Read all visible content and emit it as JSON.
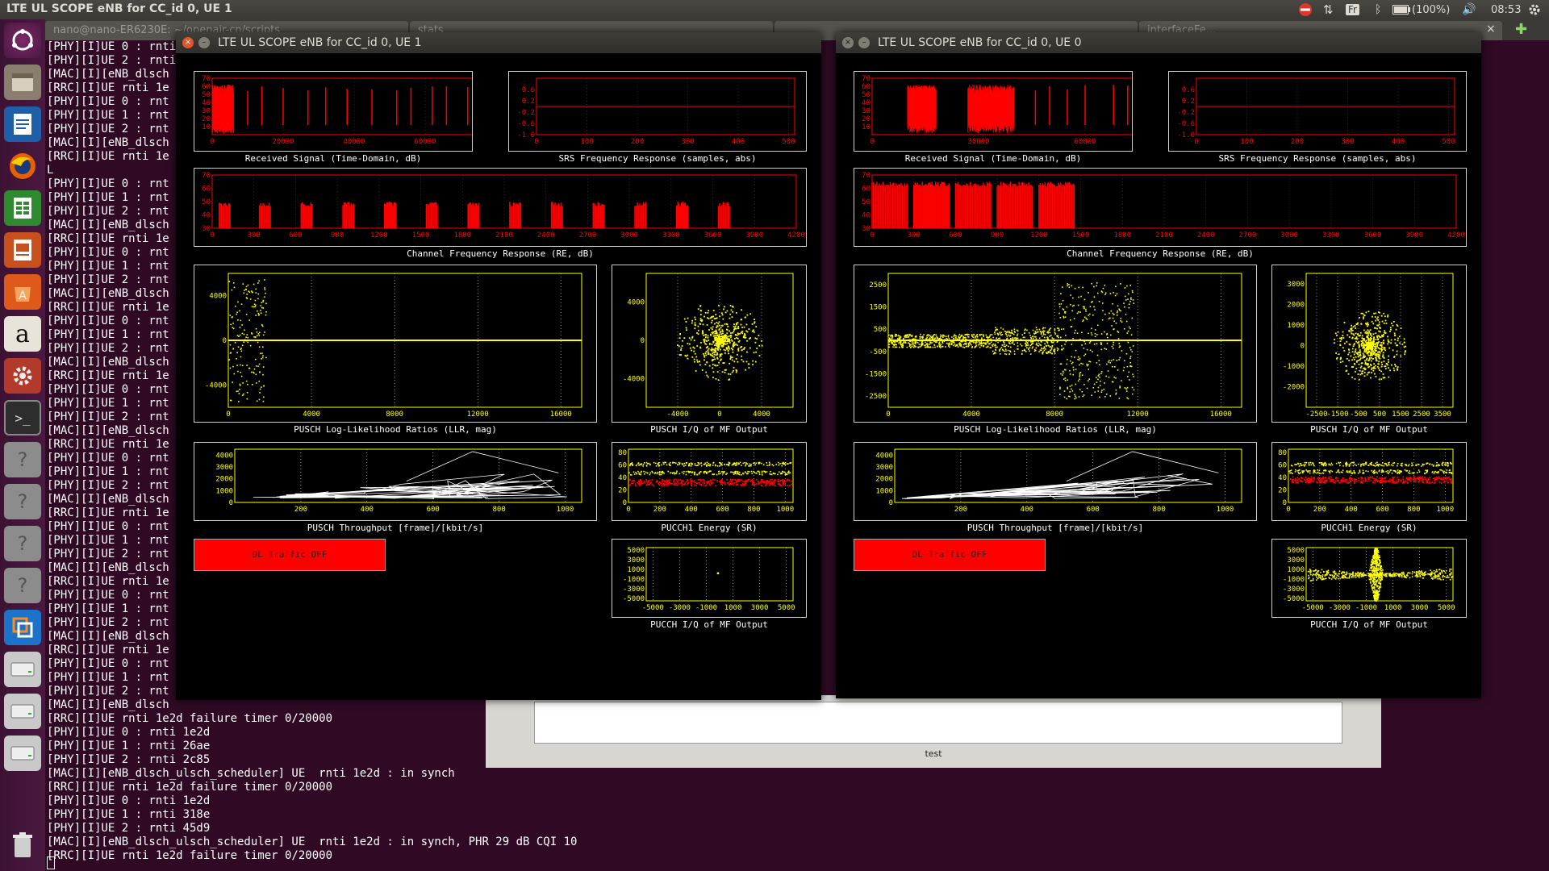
{
  "topbar": {
    "title": "LTE UL SCOPE eNB for CC_id 0, UE 1",
    "keyboard": "Fr",
    "battery": "(100%)",
    "time": "08:53"
  },
  "terminal": {
    "tabs": [
      "nano@nano-ER6230E: ~/openair-cn/scripts",
      "stats",
      "",
      "interfaceFe..."
    ],
    "lines": [
      "[PHY][I]UE 0 : rnti",
      "[PHY][I]UE 2 : rnti",
      "[MAC][I][eNB_dlsch",
      "[RRC][I]UE rnti 1e",
      "[PHY][I]UE 0 : rnt",
      "[PHY][I]UE 1 : rnt",
      "[PHY][I]UE 2 : rnt",
      "[MAC][I][eNB_dlsch",
      "[RRC][I]UE rnti 1e",
      "L",
      "[PHY][I]UE 0 : rnt",
      "[PHY][I]UE 1 : rnt",
      "[PHY][I]UE 2 : rnt",
      "[MAC][I][eNB_dlsch",
      "[RRC][I]UE rnti 1e",
      "[PHY][I]UE 0 : rnt",
      "[PHY][I]UE 1 : rnt",
      "[PHY][I]UE 2 : rnt",
      "[MAC][I][eNB_dlsch",
      "[RRC][I]UE rnti 1e",
      "[PHY][I]UE 0 : rnt",
      "[PHY][I]UE 1 : rnt",
      "[PHY][I]UE 2 : rnt",
      "[MAC][I][eNB_dlsch",
      "[RRC][I]UE rnti 1e",
      "[PHY][I]UE 0 : rnt",
      "[PHY][I]UE 1 : rnt",
      "[PHY][I]UE 2 : rnt",
      "[MAC][I][eNB_dlsch",
      "[RRC][I]UE rnti 1e",
      "[PHY][I]UE 0 : rnt",
      "[PHY][I]UE 1 : rnt",
      "[PHY][I]UE 2 : rnt",
      "[MAC][I][eNB_dlsch",
      "[RRC][I]UE rnti 1e",
      "[PHY][I]UE 0 : rnt",
      "[PHY][I]UE 1 : rnt",
      "[PHY][I]UE 2 : rnt",
      "[MAC][I][eNB_dlsch",
      "[RRC][I]UE rnti 1e",
      "[PHY][I]UE 0 : rnt",
      "[PHY][I]UE 1 : rnt",
      "[PHY][I]UE 2 : rnt",
      "[MAC][I][eNB_dlsch",
      "[RRC][I]UE rnti 1e",
      "[PHY][I]UE 0 : rnt",
      "[PHY][I]UE 1 : rnt",
      "[PHY][I]UE 2 : rnt",
      "[MAC][I][eNB_dlsch",
      "[RRC][I]UE rnti 1e2d failure timer 0/20000",
      "[PHY][I]UE 0 : rnti 1e2d",
      "[PHY][I]UE 1 : rnti 26ae",
      "[PHY][I]UE 2 : rnti 2c85",
      "[MAC][I][eNB_dlsch_ulsch_scheduler] UE  rnti 1e2d : in synch",
      "[RRC][I]UE rnti 1e2d failure timer 0/20000",
      "[PHY][I]UE 0 : rnti 1e2d",
      "[PHY][I]UE 1 : rnti 318e",
      "[PHY][I]UE 2 : rnti 45d9",
      "[MAC][I][eNB_dlsch_ulsch_scheduler] UE  rnti 1e2d : in synch, PHR 29 dB CQI 10",
      "[RRC][I]UE rnti 1e2d failure timer 0/20000"
    ]
  },
  "test_window": {
    "label": "test"
  },
  "scope_windows": [
    {
      "title": "LTE UL SCOPE eNB for CC_id 0, UE 1",
      "close": "×",
      "minimize": "–",
      "dl_button": "DL Traffic OFF",
      "plots": [
        {
          "id": "rx",
          "caption": "Received Signal (Time-Domain, dB)",
          "type": "spikes",
          "xlim": [
            0,
            75000
          ],
          "ylim": [
            0,
            70
          ],
          "xticks": [
            "0",
            "20000",
            "40000",
            "60000"
          ],
          "xtick_vals": [
            0,
            20000,
            40000,
            60000
          ],
          "yticks": [
            "70",
            "60",
            "50",
            "40",
            "30",
            "20",
            "10"
          ],
          "ytick_vals": [
            70,
            60,
            50,
            40,
            30,
            20,
            10
          ],
          "dense_region": [
            0,
            6000
          ],
          "spikes": [
            10000,
            14000,
            20000,
            27000,
            32000,
            38000,
            45000,
            52000,
            56000,
            62000,
            66000,
            72000
          ],
          "color": "#ff0000"
        },
        {
          "id": "srs",
          "caption": "SRS Frequency Response (samples, abs)",
          "type": "flat",
          "xlim": [
            0,
            512
          ],
          "ylim": [
            -1,
            1
          ],
          "xticks": [
            "0",
            "100",
            "200",
            "300",
            "400",
            "500"
          ],
          "xtick_vals": [
            0,
            100,
            200,
            300,
            400,
            500
          ],
          "yticks": [
            "0.6",
            "0.2",
            "-0.2",
            "-0.6",
            "-1.0"
          ],
          "ytick_vals": [
            0.6,
            0.2,
            -0.2,
            -0.6,
            -1.0
          ],
          "level": 0,
          "color": "#ff0000"
        },
        {
          "id": "chan",
          "caption": "Channel Frequency  Response (RE, dB)",
          "type": "blocks",
          "xlim": [
            0,
            4200
          ],
          "ylim": [
            30,
            70
          ],
          "xticks": [
            "0",
            "300",
            "600",
            "900",
            "1200",
            "1500",
            "1800",
            "2100",
            "2400",
            "2700",
            "3000",
            "3300",
            "3600",
            "3900",
            "4200"
          ],
          "xtick_vals": [
            0,
            300,
            600,
            900,
            1200,
            1500,
            1800,
            2100,
            2400,
            2700,
            3000,
            3300,
            3600,
            3900,
            4200
          ],
          "yticks": [
            "70",
            "60",
            "50",
            "40",
            "30"
          ],
          "ytick_vals": [
            70,
            60,
            50,
            40,
            30
          ],
          "blocks": [
            [
              50,
              130
            ],
            [
              340,
              420
            ],
            [
              640,
              720
            ],
            [
              940,
              1020
            ],
            [
              1240,
              1320
            ],
            [
              1540,
              1620
            ],
            [
              1840,
              1920
            ],
            [
              2140,
              2220
            ],
            [
              2440,
              2520
            ],
            [
              2740,
              2820
            ],
            [
              3040,
              3120
            ],
            [
              3340,
              3420
            ],
            [
              3640,
              3720
            ]
          ],
          "block_top": 50,
          "color": "#ff0000"
        },
        {
          "id": "llr",
          "caption": "PUSCH Log-Likelihood Ratios (LLR, mag)",
          "type": "llr",
          "xlim": [
            0,
            17000
          ],
          "ylim": [
            -6000,
            6000
          ],
          "xticks": [
            "0",
            "4000",
            "8000",
            "12000",
            "16000"
          ],
          "xtick_vals": [
            0,
            4000,
            8000,
            12000,
            16000
          ],
          "yticks": [
            "4000",
            "0",
            "-4000"
          ],
          "ytick_vals": [
            4000,
            0,
            -4000
          ],
          "noise": [
            [
              0,
              1800,
              5500
            ]
          ],
          "color": "#ffff00"
        },
        {
          "id": "iq",
          "caption": "PUSCH I/Q of MF Output",
          "type": "cloud",
          "xlim": [
            -7000,
            7000
          ],
          "ylim": [
            -7000,
            7000
          ],
          "xticks": [
            "-4000",
            "0",
            "4000"
          ],
          "xtick_vals": [
            -4000,
            0,
            4000
          ],
          "yticks": [
            "4000",
            "0",
            "-4000"
          ],
          "ytick_vals": [
            4000,
            0,
            -4000
          ],
          "spread": 2600,
          "color": "#ffff00"
        },
        {
          "id": "thr",
          "caption": "PUSCH Throughput [frame]/[kbit/s]",
          "type": "throughput",
          "xlim": [
            0,
            1050
          ],
          "ylim": [
            0,
            4500
          ],
          "xticks": [
            "200",
            "400",
            "600",
            "800",
            "1000"
          ],
          "xtick_vals": [
            200,
            400,
            600,
            800,
            1000
          ],
          "yticks": [
            "4000",
            "3000",
            "2000",
            "1000",
            "0"
          ],
          "ytick_vals": [
            4000,
            3000,
            2000,
            1000,
            0
          ],
          "peak": [
            720,
            4300
          ],
          "color": "#ffffff"
        },
        {
          "id": "pucch1",
          "caption": "PUCCH1 Energy (SR)",
          "type": "energy",
          "xlim": [
            0,
            1050
          ],
          "ylim": [
            0,
            85
          ],
          "xticks": [
            "0",
            "200",
            "400",
            "600",
            "800",
            "1000"
          ],
          "xtick_vals": [
            0,
            200,
            400,
            600,
            800,
            1000
          ],
          "yticks": [
            "80",
            "60",
            "40",
            "20",
            "0"
          ],
          "ytick_vals": [
            80,
            60,
            40,
            20,
            0
          ],
          "yellow_level": [
            62,
            48
          ],
          "red_level": 33,
          "color": "#ffff00"
        },
        {
          "id": "pucchiq",
          "caption": "PUCCH I/Q of MF Output",
          "type": "single",
          "xlim": [
            -5500,
            5500
          ],
          "ylim": [
            -5500,
            5500
          ],
          "xticks": [
            "-5000",
            "-3000",
            "-1000",
            "1000",
            "3000",
            "5000"
          ],
          "xtick_vals": [
            -5000,
            -3000,
            -1000,
            1000,
            3000,
            5000
          ],
          "yticks": [
            "5000",
            "3000",
            "1000",
            "-1000",
            "-3000",
            "-5000"
          ],
          "ytick_vals": [
            5000,
            3000,
            1000,
            -1000,
            -3000,
            -5000
          ],
          "point": [
            -200,
            400
          ],
          "color": "#ffff00"
        }
      ]
    },
    {
      "title": "LTE UL SCOPE eNB for CC_id 0, UE 0",
      "close": "×",
      "minimize": "–",
      "dl_button": "DL Traffic OFF",
      "plots": [
        {
          "id": "rx",
          "caption": "Received Signal (Time-Domain, dB)",
          "type": "spikes",
          "xlim": [
            0,
            75000
          ],
          "ylim": [
            0,
            70
          ],
          "xticks": [
            "0",
            "30000",
            "60000"
          ],
          "xtick_vals": [
            0,
            30000,
            60000
          ],
          "yticks": [
            "70",
            "60",
            "50",
            "40",
            "30",
            "20",
            "10"
          ],
          "ytick_vals": [
            70,
            60,
            50,
            40,
            30,
            20,
            10
          ],
          "dense_region": [
            10000,
            18000
          ],
          "dense_region2": [
            27000,
            40000
          ],
          "spikes": [
            46000,
            50000,
            55000,
            60000,
            68000,
            72000
          ],
          "color": "#ff0000"
        },
        {
          "id": "srs",
          "caption": "SRS Frequency Response (samples, abs)",
          "type": "flat",
          "xlim": [
            0,
            512
          ],
          "ylim": [
            -1,
            1
          ],
          "xticks": [
            "0",
            "100",
            "200",
            "300",
            "400",
            "500"
          ],
          "xtick_vals": [
            0,
            100,
            200,
            300,
            400,
            500
          ],
          "yticks": [
            "0.6",
            "0.2",
            "-0.2",
            "-0.6",
            "-1.0"
          ],
          "ytick_vals": [
            0.6,
            0.2,
            -0.2,
            -0.6,
            -1.0
          ],
          "level": 0,
          "color": "#ff0000"
        },
        {
          "id": "chan",
          "caption": "Channel Frequency  Response (RE, dB)",
          "type": "blocks",
          "xlim": [
            0,
            4200
          ],
          "ylim": [
            30,
            70
          ],
          "xticks": [
            "0",
            "300",
            "600",
            "900",
            "1200",
            "1500",
            "1800",
            "2100",
            "2400",
            "2700",
            "3000",
            "3300",
            "3600",
            "3900",
            "4200"
          ],
          "xtick_vals": [
            0,
            300,
            600,
            900,
            1200,
            1500,
            1800,
            2100,
            2400,
            2700,
            3000,
            3300,
            3600,
            3900,
            4200
          ],
          "yticks": [
            "70",
            "60",
            "50",
            "40",
            "30"
          ],
          "ytick_vals": [
            70,
            60,
            50,
            40,
            30
          ],
          "blocks": [
            [
              0,
              260
            ],
            [
              300,
              560
            ],
            [
              600,
              860
            ],
            [
              900,
              1160
            ],
            [
              1200,
              1460
            ]
          ],
          "block_top": 65,
          "color": "#ff0000"
        },
        {
          "id": "llr",
          "caption": "PUSCH Log-Likelihood Ratios (LLR, mag)",
          "type": "llr",
          "xlim": [
            0,
            17000
          ],
          "ylim": [
            -3000,
            3000
          ],
          "xticks": [
            "0",
            "4000",
            "8000",
            "12000",
            "16000"
          ],
          "xtick_vals": [
            0,
            4000,
            8000,
            12000,
            16000
          ],
          "yticks": [
            "2500",
            "1500",
            "500",
            "-500",
            "-1500",
            "-2500"
          ],
          "ytick_vals": [
            2500,
            1500,
            500,
            -500,
            -1500,
            -2500
          ],
          "noise": [
            [
              0,
              5000,
              300
            ],
            [
              5000,
              8200,
              600
            ],
            [
              8200,
              11800,
              2600
            ]
          ],
          "color": "#ffff00"
        },
        {
          "id": "iq",
          "caption": "PUSCH I/Q of MF Output",
          "type": "cloud",
          "xlim": [
            -3000,
            4000
          ],
          "ylim": [
            -3000,
            3500
          ],
          "xticks": [
            "-2500",
            "-1500",
            "-500",
            "500",
            "1500",
            "2500",
            "3500"
          ],
          "xtick_vals": [
            -2500,
            -1500,
            -500,
            500,
            1500,
            2500,
            3500
          ],
          "yticks": [
            "3000",
            "2000",
            "1000",
            "0",
            "-1000",
            "-2000"
          ],
          "ytick_vals": [
            3000,
            2000,
            1000,
            0,
            -1000,
            -2000
          ],
          "spread": 1100,
          "color": "#ffff00"
        },
        {
          "id": "thr",
          "caption": "PUSCH Throughput [frame]/[kbit/s]",
          "type": "throughput",
          "xlim": [
            0,
            1050
          ],
          "ylim": [
            0,
            4500
          ],
          "xticks": [
            "200",
            "400",
            "600",
            "800",
            "1000"
          ],
          "xtick_vals": [
            200,
            400,
            600,
            800,
            1000
          ],
          "yticks": [
            "4000",
            "3000",
            "2000",
            "1000",
            "0"
          ],
          "ytick_vals": [
            4000,
            3000,
            2000,
            1000,
            0
          ],
          "peak": [
            720,
            4300
          ],
          "color": "#ffffff"
        },
        {
          "id": "pucch1",
          "caption": "PUCCH1 Energy (SR)",
          "type": "energy",
          "xlim": [
            0,
            1050
          ],
          "ylim": [
            0,
            85
          ],
          "xticks": [
            "0",
            "200",
            "400",
            "600",
            "800",
            "1000"
          ],
          "xtick_vals": [
            0,
            200,
            400,
            600,
            800,
            1000
          ],
          "yticks": [
            "80",
            "60",
            "40",
            "20",
            "0"
          ],
          "ytick_vals": [
            80,
            60,
            40,
            20,
            0
          ],
          "yellow_level": [
            62,
            50
          ],
          "red_level": 37,
          "color": "#ffff00"
        },
        {
          "id": "pucchiq",
          "caption": "PUCCH I/Q of MF Output",
          "type": "bowtie",
          "xlim": [
            -5500,
            5500
          ],
          "ylim": [
            -5500,
            5500
          ],
          "xticks": [
            "-5000",
            "-3000",
            "-1000",
            "1000",
            "3000",
            "5000"
          ],
          "xtick_vals": [
            -5000,
            -3000,
            -1000,
            1000,
            3000,
            5000
          ],
          "yticks": [
            "5000",
            "3000",
            "1000",
            "-1000",
            "-3000",
            "-5000"
          ],
          "ytick_vals": [
            5000,
            3000,
            1000,
            -1000,
            -3000,
            -5000
          ],
          "color": "#ffff00"
        }
      ]
    }
  ]
}
